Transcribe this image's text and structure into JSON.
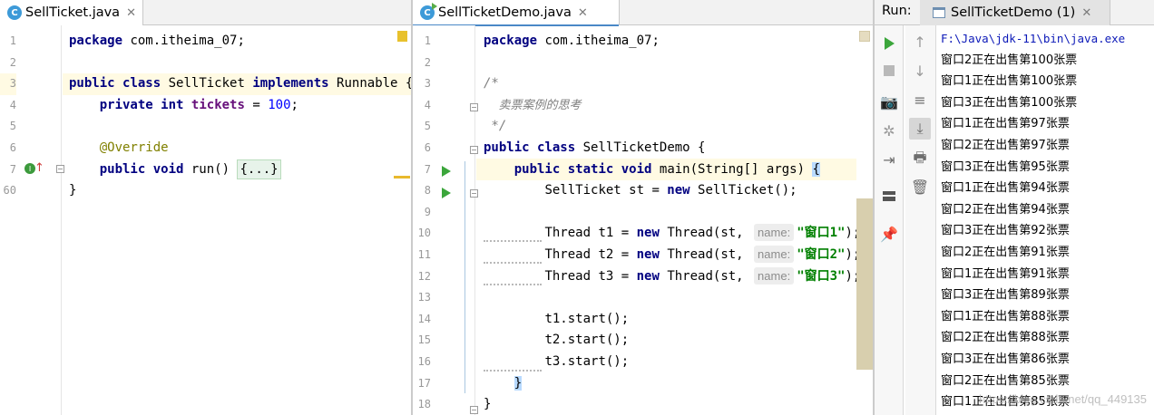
{
  "left_editor": {
    "tab_label": "SellTicket.java",
    "tab_icon": "C",
    "line_numbers": [
      "1",
      "2",
      "3",
      "4",
      "5",
      "6",
      "7",
      "60"
    ],
    "lines": {
      "l1_kw": "package",
      "l1_rest": " com.itheima_07;",
      "l3_kw1": "public",
      "l3_kw2": "class",
      "l3_name": " SellTicket ",
      "l3_kw3": "implements",
      "l3_rest": " Runnable {",
      "l4_kw1": "private",
      "l4_kw2": "int",
      "l4_field": "tickets",
      "l4_eq": " = ",
      "l4_num": "100",
      "l4_semi": ";",
      "l6_ann": "@Override",
      "l7_kw1": "public",
      "l7_kw2": "void",
      "l7_rest": " run() ",
      "l7_fold": "{...}",
      "l60": "}"
    }
  },
  "mid_editor": {
    "tab_label": "SellTicketDemo.java",
    "tab_icon": "C",
    "line_numbers": [
      "1",
      "2",
      "3",
      "4",
      "5",
      "6",
      "7",
      "8",
      "9",
      "10",
      "11",
      "12",
      "13",
      "14",
      "15",
      "16",
      "17",
      "18"
    ],
    "lines": {
      "l1_kw": "package",
      "l1_rest": " com.itheima_07;",
      "l3": "/*",
      "l4": "    卖票案例的思考",
      "l5": " */",
      "l6_kw1": "public",
      "l6_kw2": "class",
      "l6_rest": " SellTicketDemo {",
      "l7_kw1": "public",
      "l7_kw2": "static",
      "l7_kw3": "void",
      "l7_rest": " main(String[] args) ",
      "l7_brace": "{",
      "l8_a": "SellTicket st = ",
      "l8_kw": "new",
      "l8_b": " SellTicket();",
      "l10_a": "Thread t1 = ",
      "l10_kw": "new",
      "l10_b": " Thread(st, ",
      "l10_hint": "name:",
      "l10_str": "\"窗口1\"",
      "l10_c": ");",
      "l11_a": "Thread t2 = ",
      "l11_kw": "new",
      "l11_b": " Thread(st, ",
      "l11_hint": "name:",
      "l11_str": "\"窗口2\"",
      "l11_c": ");",
      "l12_a": "Thread t3 = ",
      "l12_kw": "new",
      "l12_b": " Thread(st, ",
      "l12_hint": "name:",
      "l12_str": "\"窗口3\"",
      "l12_c": ");",
      "l14": "t1.start();",
      "l15": "t2.start();",
      "l16": "t3.start();",
      "l17": "}",
      "l18": "}"
    }
  },
  "run_panel": {
    "title": "Run:",
    "tab_label": "SellTicketDemo (1)",
    "toolbar_left": [
      "rerun-icon",
      "stop-icon",
      "camera-icon",
      "debug-bug-icon",
      "login-icon",
      "layout-icon",
      "pin-icon"
    ],
    "toolbar_right": [
      "arrow-up-icon",
      "arrow-down-icon",
      "soft-wrap-icon",
      "scroll-to-end-icon",
      "print-icon",
      "trash-icon"
    ],
    "console": [
      "F:\\Java\\jdk-11\\bin\\java.exe",
      "窗口2正在出售第100张票",
      "窗口1正在出售第100张票",
      "窗口3正在出售第100张票",
      "窗口1正在出售第97张票",
      "窗口2正在出售第97张票",
      "窗口3正在出售第95张票",
      "窗口1正在出售第94张票",
      "窗口2正在出售第94张票",
      "窗口3正在出售第92张票",
      "窗口2正在出售第91张票",
      "窗口1正在出售第91张票",
      "窗口3正在出售第89张票",
      "窗口1正在出售第88张票",
      "窗口2正在出售第88张票",
      "窗口3正在出售第86张票",
      "窗口2正在出售第85张票",
      "窗口1正在出售第85张票"
    ],
    "watermark": "https://blog.csdn.net/qq_449135"
  },
  "colors": {
    "keyword": "#000080",
    "string": "#008000",
    "field": "#660e7a",
    "annotation": "#808000",
    "comment": "#808080",
    "run_green": "#3ba63b",
    "console_path": "#0d1ab8"
  }
}
